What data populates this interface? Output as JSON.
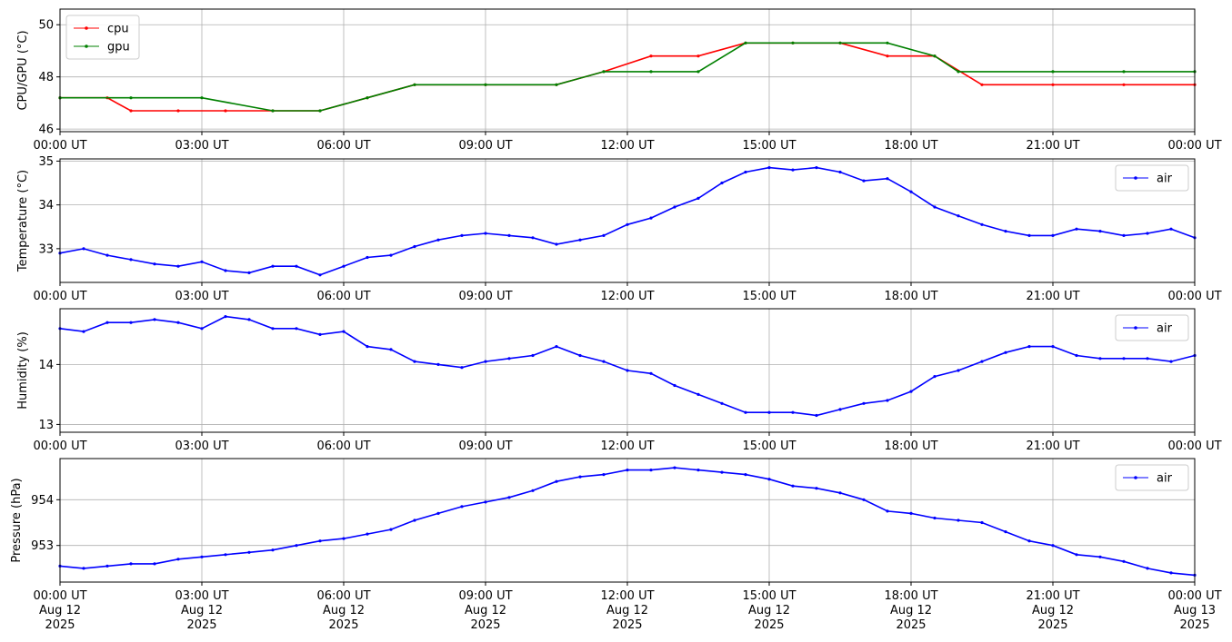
{
  "colors": {
    "cpu": "#ff0000",
    "gpu": "#008000",
    "air": "#0000ff",
    "grid": "#b0b0b0",
    "axes": "#000000"
  },
  "chart_data": [
    {
      "type": "line",
      "ylabel": "CPU/GPU (°C)",
      "xlabel": "",
      "xlim": [
        "2025-08-12T00:00",
        "2025-08-13T00:00"
      ],
      "ylim": [
        45.9,
        50.6
      ],
      "yticks": [
        46,
        48,
        50
      ],
      "grid": true,
      "legend": "top-left",
      "x_tick_labels": [
        "00:00 UT",
        "03:00 UT",
        "06:00 UT",
        "09:00 UT",
        "12:00 UT",
        "15:00 UT",
        "18:00 UT",
        "21:00 UT",
        "00:00 UT"
      ],
      "series": [
        {
          "name": "cpu",
          "color": "#ff0000",
          "x": [
            "2025-08-12T00:00",
            "2025-08-12T01:00",
            "2025-08-12T01:30",
            "2025-08-12T02:30",
            "2025-08-12T03:30",
            "2025-08-12T04:30",
            "2025-08-12T05:30",
            "2025-08-12T06:30",
            "2025-08-12T07:30",
            "2025-08-12T09:00",
            "2025-08-12T10:30",
            "2025-08-12T11:30",
            "2025-08-12T12:30",
            "2025-08-12T13:30",
            "2025-08-12T14:30",
            "2025-08-12T15:30",
            "2025-08-12T16:30",
            "2025-08-12T17:30",
            "2025-08-12T18:30",
            "2025-08-12T19:30",
            "2025-08-12T21:00",
            "2025-08-12T22:30",
            "2025-08-13T00:00"
          ],
          "y": [
            47.2,
            47.2,
            46.7,
            46.7,
            46.7,
            46.7,
            46.7,
            47.2,
            47.7,
            47.7,
            47.7,
            48.2,
            48.8,
            48.8,
            49.3,
            49.3,
            49.3,
            48.8,
            48.8,
            47.7,
            47.7,
            47.7,
            47.7
          ]
        },
        {
          "name": "gpu",
          "color": "#008000",
          "x": [
            "2025-08-12T00:00",
            "2025-08-12T01:30",
            "2025-08-12T03:00",
            "2025-08-12T04:30",
            "2025-08-12T05:30",
            "2025-08-12T06:30",
            "2025-08-12T07:30",
            "2025-08-12T09:00",
            "2025-08-12T10:30",
            "2025-08-12T11:30",
            "2025-08-12T12:30",
            "2025-08-12T13:30",
            "2025-08-12T14:30",
            "2025-08-12T15:30",
            "2025-08-12T16:30",
            "2025-08-12T17:30",
            "2025-08-12T18:30",
            "2025-08-12T19:00",
            "2025-08-12T21:00",
            "2025-08-12T22:30",
            "2025-08-13T00:00"
          ],
          "y": [
            47.2,
            47.2,
            47.2,
            46.7,
            46.7,
            47.2,
            47.7,
            47.7,
            47.7,
            48.2,
            48.2,
            48.2,
            49.3,
            49.3,
            49.3,
            49.3,
            48.8,
            48.2,
            48.2,
            48.2,
            48.2
          ]
        }
      ]
    },
    {
      "type": "line",
      "ylabel": "Temperature (°C)",
      "xlabel": "",
      "xlim": [
        "2025-08-12T00:00",
        "2025-08-13T00:00"
      ],
      "ylim": [
        32.23,
        35.05
      ],
      "yticks": [
        33,
        34,
        35
      ],
      "grid": true,
      "legend": "top-right",
      "x_tick_labels": [
        "00:00 UT",
        "03:00 UT",
        "06:00 UT",
        "09:00 UT",
        "12:00 UT",
        "15:00 UT",
        "18:00 UT",
        "21:00 UT",
        "00:00 UT"
      ],
      "series": [
        {
          "name": "air",
          "color": "#0000ff",
          "x": [
            "2025-08-12T00:00",
            "2025-08-12T00:30",
            "2025-08-12T01:00",
            "2025-08-12T01:30",
            "2025-08-12T02:00",
            "2025-08-12T02:30",
            "2025-08-12T03:00",
            "2025-08-12T03:30",
            "2025-08-12T04:00",
            "2025-08-12T04:30",
            "2025-08-12T05:00",
            "2025-08-12T05:30",
            "2025-08-12T06:00",
            "2025-08-12T06:30",
            "2025-08-12T07:00",
            "2025-08-12T07:30",
            "2025-08-12T08:00",
            "2025-08-12T08:30",
            "2025-08-12T09:00",
            "2025-08-12T09:30",
            "2025-08-12T10:00",
            "2025-08-12T10:30",
            "2025-08-12T11:00",
            "2025-08-12T11:30",
            "2025-08-12T12:00",
            "2025-08-12T12:30",
            "2025-08-12T13:00",
            "2025-08-12T13:30",
            "2025-08-12T14:00",
            "2025-08-12T14:30",
            "2025-08-12T15:00",
            "2025-08-12T15:30",
            "2025-08-12T16:00",
            "2025-08-12T16:30",
            "2025-08-12T17:00",
            "2025-08-12T17:30",
            "2025-08-12T18:00",
            "2025-08-12T18:30",
            "2025-08-12T19:00",
            "2025-08-12T19:30",
            "2025-08-12T20:00",
            "2025-08-12T20:30",
            "2025-08-12T21:00",
            "2025-08-12T21:30",
            "2025-08-12T22:00",
            "2025-08-12T22:30",
            "2025-08-12T23:00",
            "2025-08-12T23:30",
            "2025-08-13T00:00"
          ],
          "y": [
            32.9,
            33.0,
            32.85,
            32.75,
            32.65,
            32.6,
            32.7,
            32.5,
            32.45,
            32.6,
            32.6,
            32.4,
            32.6,
            32.8,
            32.85,
            33.05,
            33.2,
            33.3,
            33.35,
            33.3,
            33.25,
            33.1,
            33.2,
            33.3,
            33.55,
            33.7,
            33.95,
            34.15,
            34.5,
            34.75,
            34.85,
            34.8,
            34.85,
            34.75,
            34.55,
            34.6,
            34.3,
            33.95,
            33.75,
            33.55,
            33.4,
            33.3,
            33.3,
            33.45,
            33.4,
            33.3,
            33.35,
            33.45,
            33.25
          ]
        }
      ]
    },
    {
      "type": "line",
      "ylabel": "Humidity (%)",
      "xlabel": "",
      "xlim": [
        "2025-08-12T00:00",
        "2025-08-13T00:00"
      ],
      "ylim": [
        12.87,
        14.93
      ],
      "yticks": [
        13,
        14
      ],
      "grid": true,
      "legend": "top-right",
      "x_tick_labels": [
        "00:00 UT",
        "03:00 UT",
        "06:00 UT",
        "09:00 UT",
        "12:00 UT",
        "15:00 UT",
        "18:00 UT",
        "21:00 UT",
        "00:00 UT"
      ],
      "series": [
        {
          "name": "air",
          "color": "#0000ff",
          "x": [
            "2025-08-12T00:00",
            "2025-08-12T00:30",
            "2025-08-12T01:00",
            "2025-08-12T01:30",
            "2025-08-12T02:00",
            "2025-08-12T02:30",
            "2025-08-12T03:00",
            "2025-08-12T03:30",
            "2025-08-12T04:00",
            "2025-08-12T04:30",
            "2025-08-12T05:00",
            "2025-08-12T05:30",
            "2025-08-12T06:00",
            "2025-08-12T06:30",
            "2025-08-12T07:00",
            "2025-08-12T07:30",
            "2025-08-12T08:00",
            "2025-08-12T08:30",
            "2025-08-12T09:00",
            "2025-08-12T09:30",
            "2025-08-12T10:00",
            "2025-08-12T10:30",
            "2025-08-12T11:00",
            "2025-08-12T11:30",
            "2025-08-12T12:00",
            "2025-08-12T12:30",
            "2025-08-12T13:00",
            "2025-08-12T13:30",
            "2025-08-12T14:00",
            "2025-08-12T14:30",
            "2025-08-12T15:00",
            "2025-08-12T15:30",
            "2025-08-12T16:00",
            "2025-08-12T16:30",
            "2025-08-12T17:00",
            "2025-08-12T17:30",
            "2025-08-12T18:00",
            "2025-08-12T18:30",
            "2025-08-12T19:00",
            "2025-08-12T19:30",
            "2025-08-12T20:00",
            "2025-08-12T20:30",
            "2025-08-12T21:00",
            "2025-08-12T21:30",
            "2025-08-12T22:00",
            "2025-08-12T22:30",
            "2025-08-12T23:00",
            "2025-08-12T23:30",
            "2025-08-13T00:00"
          ],
          "y": [
            14.6,
            14.55,
            14.7,
            14.7,
            14.75,
            14.7,
            14.6,
            14.8,
            14.75,
            14.6,
            14.6,
            14.5,
            14.55,
            14.3,
            14.25,
            14.05,
            14.0,
            13.95,
            14.05,
            14.1,
            14.15,
            14.3,
            14.15,
            14.05,
            13.9,
            13.85,
            13.65,
            13.5,
            13.35,
            13.2,
            13.2,
            13.2,
            13.15,
            13.25,
            13.35,
            13.4,
            13.55,
            13.8,
            13.9,
            14.05,
            14.2,
            14.3,
            14.3,
            14.15,
            14.1,
            14.1,
            14.1,
            14.05,
            14.15
          ]
        }
      ]
    },
    {
      "type": "line",
      "ylabel": "Pressure (hPa)",
      "xlabel": "",
      "xlim": [
        "2025-08-12T00:00",
        "2025-08-13T00:00"
      ],
      "ylim": [
        952.2,
        954.9
      ],
      "yticks": [
        953,
        954
      ],
      "grid": true,
      "legend": "top-right",
      "x_tick_labels": [
        "00:00 UT\nAug 12\n2025",
        "03:00 UT\nAug 12\n2025",
        "06:00 UT\nAug 12\n2025",
        "09:00 UT\nAug 12\n2025",
        "12:00 UT\nAug 12\n2025",
        "15:00 UT\nAug 12\n2025",
        "18:00 UT\nAug 12\n2025",
        "21:00 UT\nAug 12\n2025",
        "00:00 UT\nAug 13\n2025"
      ],
      "series": [
        {
          "name": "air",
          "color": "#0000ff",
          "x": [
            "2025-08-12T00:00",
            "2025-08-12T00:30",
            "2025-08-12T01:00",
            "2025-08-12T01:30",
            "2025-08-12T02:00",
            "2025-08-12T02:30",
            "2025-08-12T03:00",
            "2025-08-12T03:30",
            "2025-08-12T04:00",
            "2025-08-12T04:30",
            "2025-08-12T05:00",
            "2025-08-12T05:30",
            "2025-08-12T06:00",
            "2025-08-12T06:30",
            "2025-08-12T07:00",
            "2025-08-12T07:30",
            "2025-08-12T08:00",
            "2025-08-12T08:30",
            "2025-08-12T09:00",
            "2025-08-12T09:30",
            "2025-08-12T10:00",
            "2025-08-12T10:30",
            "2025-08-12T11:00",
            "2025-08-12T11:30",
            "2025-08-12T12:00",
            "2025-08-12T12:30",
            "2025-08-12T13:00",
            "2025-08-12T13:30",
            "2025-08-12T14:00",
            "2025-08-12T14:30",
            "2025-08-12T15:00",
            "2025-08-12T15:30",
            "2025-08-12T16:00",
            "2025-08-12T16:30",
            "2025-08-12T17:00",
            "2025-08-12T17:30",
            "2025-08-12T18:00",
            "2025-08-12T18:30",
            "2025-08-12T19:00",
            "2025-08-12T19:30",
            "2025-08-12T20:00",
            "2025-08-12T20:30",
            "2025-08-12T21:00",
            "2025-08-12T21:30",
            "2025-08-12T22:00",
            "2025-08-12T22:30",
            "2025-08-12T23:00",
            "2025-08-12T23:30",
            "2025-08-13T00:00"
          ],
          "y": [
            952.55,
            952.5,
            952.55,
            952.6,
            952.6,
            952.7,
            952.75,
            952.8,
            952.85,
            952.9,
            953.0,
            953.1,
            953.15,
            953.25,
            953.35,
            953.55,
            953.7,
            953.85,
            953.95,
            954.05,
            954.2,
            954.4,
            954.5,
            954.55,
            954.65,
            954.65,
            954.7,
            954.65,
            954.6,
            954.55,
            954.45,
            954.3,
            954.25,
            954.15,
            954.0,
            953.75,
            953.7,
            953.6,
            953.55,
            953.5,
            953.3,
            953.1,
            953.0,
            952.8,
            952.75,
            952.65,
            952.5,
            952.4,
            952.35
          ]
        }
      ]
    }
  ]
}
